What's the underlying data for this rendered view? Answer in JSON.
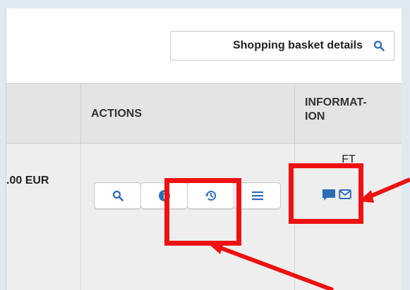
{
  "toolbar": {
    "basket_details_label": "Shopping basket details",
    "basket_icon": "search-icon"
  },
  "table": {
    "columns": [
      {
        "label": "ACTIONS"
      },
      {
        "label": "INFORMAT-\nION"
      }
    ],
    "row": {
      "price": ".00 EUR",
      "info_code": "FT",
      "actions": [
        "search-icon",
        "info-icon",
        "history-icon",
        "list-icon"
      ],
      "info_icons": [
        "comment-icon",
        "mail-icon"
      ]
    }
  },
  "colors": {
    "icon_blue": "#2a6db5",
    "highlight_red": "#ee1111",
    "header_bg": "#e4e4e4",
    "row_bg": "#eeeeee"
  }
}
